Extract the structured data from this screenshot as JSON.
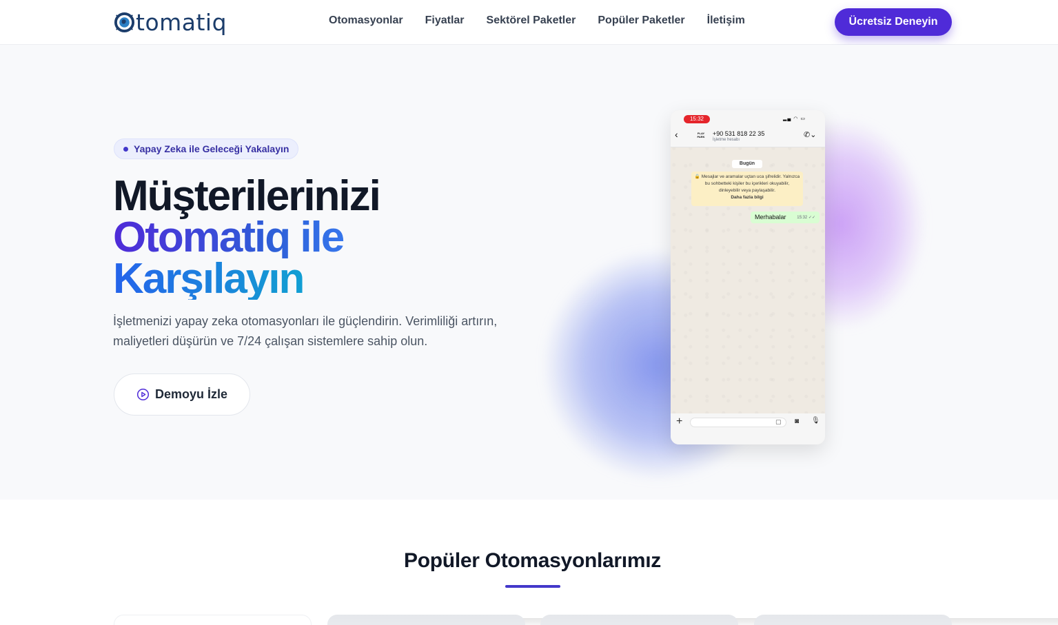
{
  "header": {
    "logo_text": "tomatiq",
    "nav": [
      "Otomasyonlar",
      "Fiyatlar",
      "Sektörel Paketler",
      "Popüler Paketler",
      "İletişim"
    ],
    "cta_label": "Ücretsiz Deneyin"
  },
  "hero": {
    "badge": "Yapay Zeka ile Geleceği Yakalayın",
    "title_line1": "Müşterilerinizi",
    "title_line2": "Otomatiq ile",
    "title_line3": "Karşılayın",
    "description": "İşletmenizi yapay zeka otomasyonları ile güçlendirin. Verimliliği artırın, maliyetleri düşürün ve 7/24 çalışan sistemlere sahip olun.",
    "demo_button": "Demoyu İzle"
  },
  "phone": {
    "time": "15:32",
    "avatar_text": "PLAY PARK",
    "contact_number": "+90 531 818 22 35",
    "contact_sub": "İşletme hesabı",
    "date_chip": "Bugün",
    "encryption_notice": "🔒 Mesajlar ve aramalar uçtan uca şifrelidir. Yalnızca bu sohbetteki kişiler bu içerikleri okuyabilir, dinleyebilir veya paylaşabilir.",
    "encryption_link": "Daha fazla bilgi",
    "message_text": "Merhabalar",
    "message_time": "15:32 ✓✓"
  },
  "section": {
    "title": "Popüler Otomasyonlarımız"
  },
  "colors": {
    "brand": "#4f2bd8",
    "accent_blue": "#2563eb",
    "accent_cyan": "#06b6d4",
    "logo": "#1c3d6b"
  }
}
